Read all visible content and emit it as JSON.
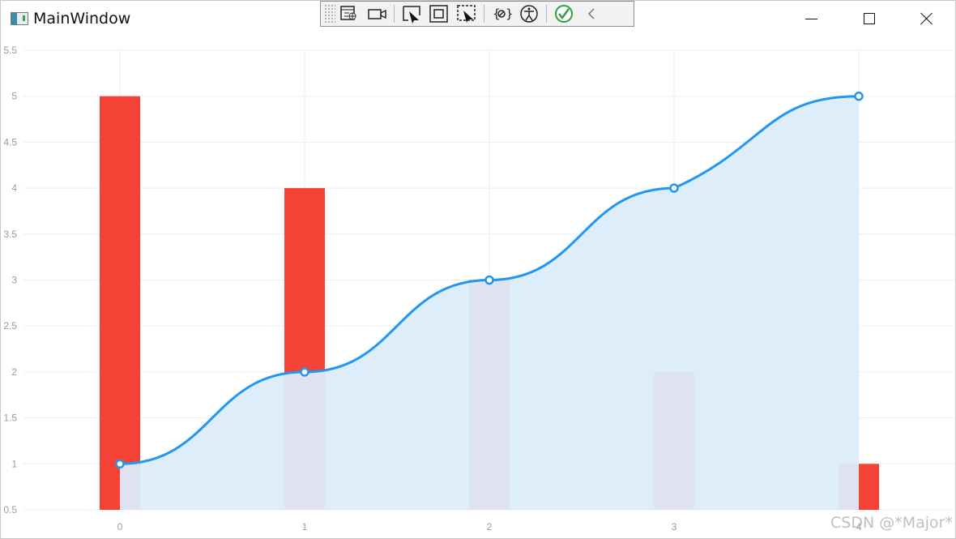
{
  "window": {
    "title": "MainWindow",
    "icon": "app-window-icon",
    "controls": [
      "minimize-icon",
      "maximize-icon",
      "close-icon"
    ]
  },
  "devbar": {
    "tools": [
      "live-visual-tree-icon",
      "video-camera-icon",
      "select-element-icon",
      "display-layout-adorners-icon",
      "track-focused-element-icon",
      "binding-failures-icon",
      "accessibility-icon",
      "check-icon",
      "collapse-chevron-icon"
    ],
    "accent": "#2f9e44"
  },
  "chart_data": {
    "type": "bar",
    "categories": [
      "0",
      "1",
      "2",
      "3",
      "4"
    ],
    "series": [
      {
        "type": "bar",
        "values": [
          5,
          4,
          3,
          2,
          1
        ],
        "color": "#f44336"
      },
      {
        "type": "area",
        "values": [
          1,
          2,
          3,
          4,
          5
        ],
        "color": "#2196f3",
        "fill": "#dcecfa",
        "smooth": true
      }
    ],
    "xlabel": "",
    "ylabel": "",
    "ylim": [
      0.5,
      5.5
    ],
    "yticks": [
      "0.5",
      "1",
      "1.5",
      "2",
      "2.5",
      "3",
      "3.5",
      "4",
      "4.5",
      "5",
      "5.5"
    ],
    "grid": true,
    "legend": "none"
  },
  "watermark": "CSDN @*Major*"
}
